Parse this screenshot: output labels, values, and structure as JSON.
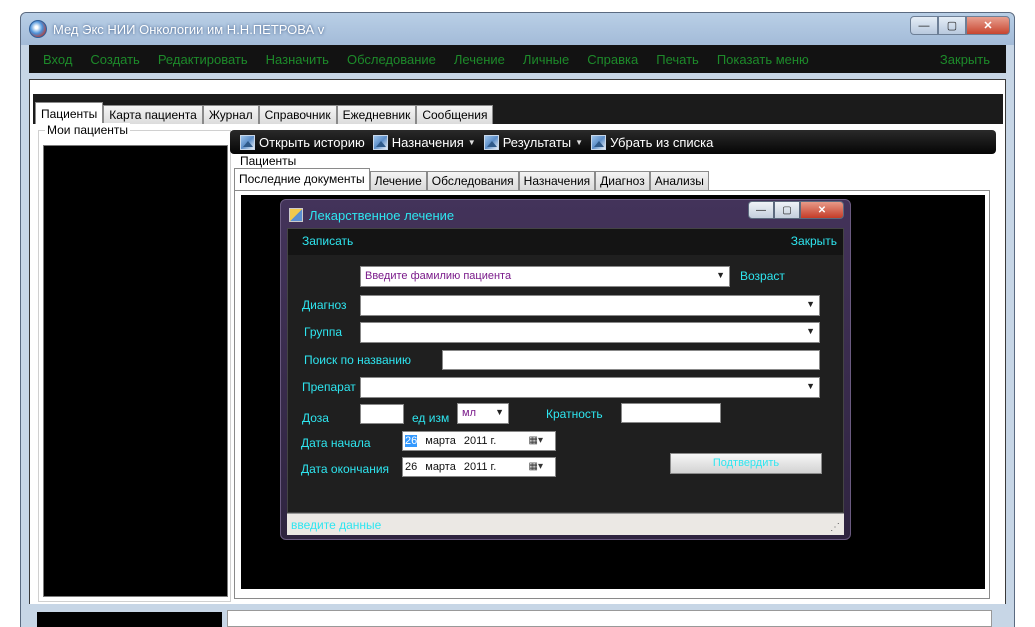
{
  "window": {
    "title": "Мед Экс НИИ Онкологии им Н.Н.ПЕТРОВА v",
    "minimize": "—",
    "maximize": "▢",
    "close": "✕"
  },
  "menu": {
    "items": [
      "Вход",
      "Создать",
      "Редактировать",
      "Назначить",
      "Обследование",
      "Лечение",
      "Личные",
      "Справка",
      "Печать",
      "Показать меню"
    ],
    "close_label": "Закрыть"
  },
  "main_tabs": [
    "Пациенты",
    "Карта пациента",
    "Журнал",
    "Справочник",
    "Ежедневник",
    "Сообщения"
  ],
  "left_panel": {
    "group_label": "Мои пациенты"
  },
  "toolbar": {
    "open_history": "Открыть историю",
    "assignments": "Назначения",
    "results": "Результаты",
    "remove": "Убрать из списка"
  },
  "patients_section": {
    "label": "Пациенты",
    "tabs": [
      "Последние документы",
      "Лечение",
      "Обследования",
      "Назначения",
      "Диагноз",
      "Анализы"
    ]
  },
  "dialog": {
    "title": "Лекарственное лечение",
    "menu_save": "Записать",
    "menu_close": "Закрыть",
    "patient_placeholder": "Введите фамилию пациента",
    "age_label": "Возраст",
    "diagnosis_label": "Диагноз",
    "group_label": "Группа",
    "search_label": "Поиск по названию",
    "drug_label": "Препарат",
    "dose_label": "Доза",
    "unit_label": "ед изм",
    "unit_value": "мл",
    "frequency_label": "Кратность",
    "start_label": "Дата начала",
    "end_label": "Дата окончания",
    "start_date": {
      "day": "26",
      "month": "марта",
      "year": "2011 г."
    },
    "end_date": {
      "day": "26",
      "month": "марта",
      "year": "2011 г."
    },
    "confirm_label": "Подтвердить",
    "status_text": "введите данные"
  },
  "colors": {
    "menu_text": "#1d8a2a",
    "dialog_text": "#2ee6f0",
    "dark_bg": "#121212"
  }
}
